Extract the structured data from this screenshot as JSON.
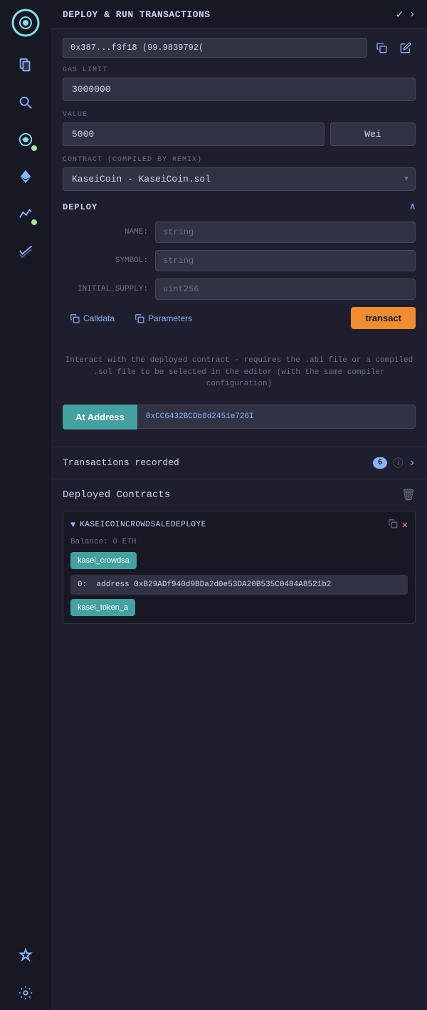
{
  "header": {
    "title": "DEPLOY & RUN TRANSACTIONS",
    "check": "✓"
  },
  "account": {
    "value": "0x387...f3f18 (99.9839792(",
    "copy_label": "copy",
    "edit_label": "edit"
  },
  "gas_limit": {
    "label": "GAS LIMIT",
    "value": "3000000"
  },
  "value_field": {
    "label": "VALUE",
    "amount": "5000",
    "unit": "Wei"
  },
  "contract": {
    "label": "CONTRACT  (Compiled by Remix)",
    "value": "KaseiCoin - KaseiCoin.sol"
  },
  "deploy": {
    "title": "DEPLOY",
    "fields": [
      {
        "label": "NAME:",
        "placeholder": "string"
      },
      {
        "label": "SYMBOL:",
        "placeholder": "string"
      },
      {
        "label": "INITIAL_SUPPLY:",
        "placeholder": "uint256"
      }
    ],
    "calldata_label": "Calldata",
    "params_label": "Parameters",
    "transact_label": "transact"
  },
  "info_text": "Interact with the deployed contract - requires the .abi file or a compiled .sol file to be selected in the editor (with the same compiler configuration)",
  "at_address": {
    "label": "At Address",
    "value": "0xCC6432BCDb8d2451e726I"
  },
  "transactions": {
    "label": "Transactions recorded",
    "count": "6",
    "info": "ⓘ"
  },
  "deployed_contracts": {
    "title": "Deployed Contracts",
    "trash": "🗑",
    "contract_name": "KASEICOINCROWDSALEDEPLOYE",
    "balance": "Balance: 0 ETH",
    "fn_button": "kasei_crowdsa",
    "address_label": "0:",
    "address_key": "address",
    "address_value": "0xB29ADf940d9BDa2d0e53DA20B535C0484A8521b2",
    "fn_button2": "kasei_token_a"
  },
  "sidebar": {
    "icons": [
      {
        "id": "logo",
        "glyph": "◉",
        "label": "logo"
      },
      {
        "id": "file",
        "glyph": "📋",
        "label": "file-icon"
      },
      {
        "id": "search",
        "glyph": "🔍",
        "label": "search-icon"
      },
      {
        "id": "deploy",
        "glyph": "⚙",
        "label": "deploy-icon",
        "badge": true
      },
      {
        "id": "eth",
        "glyph": "◆",
        "label": "ethereum-icon"
      },
      {
        "id": "analytics",
        "glyph": "📈",
        "label": "analytics-icon",
        "badge": true
      },
      {
        "id": "double-check",
        "glyph": "✔✔",
        "label": "verify-icon"
      },
      {
        "id": "plugin",
        "glyph": "✱",
        "label": "plugin-icon"
      },
      {
        "id": "settings",
        "glyph": "⚙",
        "label": "settings-icon"
      }
    ]
  }
}
